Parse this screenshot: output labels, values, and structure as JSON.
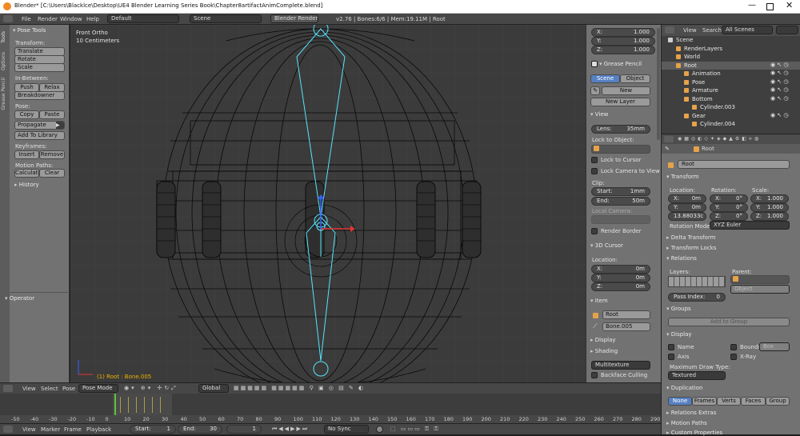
{
  "window": {
    "title": "Blender* [C:\\Users\\Blacklce\\Desktop\\UE4 Blender Learning Series Book\\Chapter8artifactAnimComplete.blend]"
  },
  "topbar": {
    "menus": [
      "File",
      "Render",
      "Window",
      "Help"
    ],
    "layout": "Default",
    "scene": "Scene",
    "engine": "Blender Render",
    "stats": "v2.76 | Bones:6/6 | Mem:19.11M | Root"
  },
  "toolshelf": {
    "tabs": [
      "Tools",
      "Options",
      "Grease Pencil"
    ],
    "title": "Pose Tools",
    "transform_label": "Transform:",
    "translate": "Translate",
    "rotate": "Rotate",
    "scale": "Scale",
    "inbetween_label": "In-Between:",
    "push": "Push",
    "relax": "Relax",
    "breakdowner": "Breakdowner",
    "pose_label": "Pose:",
    "copy": "Copy",
    "paste": "Paste",
    "propagate": "Propagate",
    "add_library": "Add To Library",
    "keyframes_label": "Keyframes:",
    "insert": "Insert",
    "remove": "Remove",
    "motion_label": "Motion Paths:",
    "calculate": "Calculate",
    "clear": "Clear",
    "history": "History",
    "operator": "Operator"
  },
  "viewport": {
    "view_name": "Front Ortho",
    "scale": "10 Centimeters",
    "info": "(1) Root : Bone.005",
    "colors": {
      "bone": "#55e5ff",
      "mesh": "#000000",
      "bg": "#3b3b3b",
      "grid": "#444444"
    }
  },
  "vp_header": {
    "view": "View",
    "select": "Select",
    "pose": "Pose",
    "mode": "Pose Mode",
    "orientation": "Global"
  },
  "npanel": {
    "scale": {
      "x_label": "X:",
      "x": "1.000",
      "y_label": "Y:",
      "y": "1.000",
      "z_label": "Z:",
      "z": "1.000"
    },
    "grease_pencil": "Grease Pencil",
    "gp_scene": "Scene",
    "gp_object": "Object",
    "gp_new": "New",
    "gp_new_layer": "New Layer",
    "view": "View",
    "lens_label": "Lens:",
    "lens": "35mm",
    "lock_object": "Lock to Object:",
    "lock_cursor": "Lock to Cursor",
    "lock_camera": "Lock Camera to View",
    "clip": "Clip:",
    "start_label": "Start:",
    "start": "1mm",
    "end_label": "End:",
    "end": "50m",
    "local_camera": "Local Camera:",
    "render_border": "Render Border",
    "cursor": "3D Cursor",
    "location": "Location:",
    "cx_label": "X:",
    "cx": "0m",
    "cy_label": "Y:",
    "cy": "0m",
    "cz_label": "Z:",
    "cz": "0m",
    "item": "Item",
    "item_obj": "Root",
    "item_bone": "Bone.005",
    "display": "Display",
    "shading": "Shading",
    "shading_mode": "Multitexture",
    "backface": "Backface Culling"
  },
  "outliner": {
    "view": "View",
    "search": "Search",
    "filter": "All Scenes",
    "items": [
      {
        "label": "Scene",
        "indent": 0
      },
      {
        "label": "RenderLayers",
        "indent": 1
      },
      {
        "label": "World",
        "indent": 1
      },
      {
        "label": "Root",
        "indent": 1
      },
      {
        "label": "Animation",
        "indent": 2
      },
      {
        "label": "Pose",
        "indent": 2
      },
      {
        "label": "Armature",
        "indent": 2
      },
      {
        "label": "Bottom",
        "indent": 2
      },
      {
        "label": "Cylinder.003",
        "indent": 3
      },
      {
        "label": "Gear",
        "indent": 2
      },
      {
        "label": "Cylinder.004",
        "indent": 3
      }
    ]
  },
  "properties": {
    "breadcrumb": "Root",
    "name": "Root",
    "transform": "Transform",
    "location": "Location:",
    "rotation": "Rotation:",
    "scale": "Scale:",
    "loc": [
      {
        "l": "X:",
        "v": "0m"
      },
      {
        "l": "Y:",
        "v": "0m"
      },
      {
        "l": "",
        "v": "13.88033c"
      }
    ],
    "rot": [
      {
        "l": "X:",
        "v": "0°"
      },
      {
        "l": "Y:",
        "v": "0°"
      },
      {
        "l": "Z:",
        "v": "0°"
      }
    ],
    "scl": [
      {
        "l": "X:",
        "v": "1.000"
      },
      {
        "l": "Y:",
        "v": "1.000"
      },
      {
        "l": "Z:",
        "v": "1.000"
      }
    ],
    "rotation_mode_label": "Rotation Mode:",
    "rotation_mode": "XYZ Euler",
    "delta": "Delta Transform",
    "locks": "Transform Locks",
    "relations": "Relations",
    "layers": "Layers:",
    "parent": "Parent:",
    "parent_type": "Object",
    "pass_index_label": "Pass Index:",
    "pass_index": "0",
    "groups": "Groups",
    "add_group": "Add to Group",
    "display": "Display",
    "name_cb": "Name",
    "axis_cb": "Axis",
    "bounds_cb": "Bounds",
    "bounds_type": "Box",
    "xray_cb": "X-Ray",
    "max_draw": "Maximum Draw Type:",
    "max_draw_val": "Textured",
    "duplication": "Duplication",
    "dup_none": "None",
    "dup_frames": "Frames",
    "dup_verts": "Verts",
    "dup_faces": "Faces",
    "dup_group": "Group",
    "rel_extras": "Relations Extras",
    "motion_paths": "Motion Paths",
    "custom_props": "Custom Properties"
  },
  "timeline": {
    "ticks": [
      "-50",
      "-40",
      "-30",
      "-20",
      "-10",
      "0",
      "10",
      "20",
      "30",
      "40",
      "50",
      "60",
      "70",
      "80",
      "90",
      "100",
      "110",
      "120",
      "130",
      "140",
      "150",
      "160",
      "170",
      "180",
      "190",
      "200",
      "210",
      "220",
      "230",
      "240",
      "250",
      "260",
      "270",
      "280",
      "290"
    ],
    "view": "View",
    "marker": "Marker",
    "frame": "Frame",
    "playback": "Playback",
    "start_label": "Start:",
    "start": "1",
    "end_label": "End:",
    "end": "30",
    "current": "1",
    "sync": "No Sync"
  }
}
